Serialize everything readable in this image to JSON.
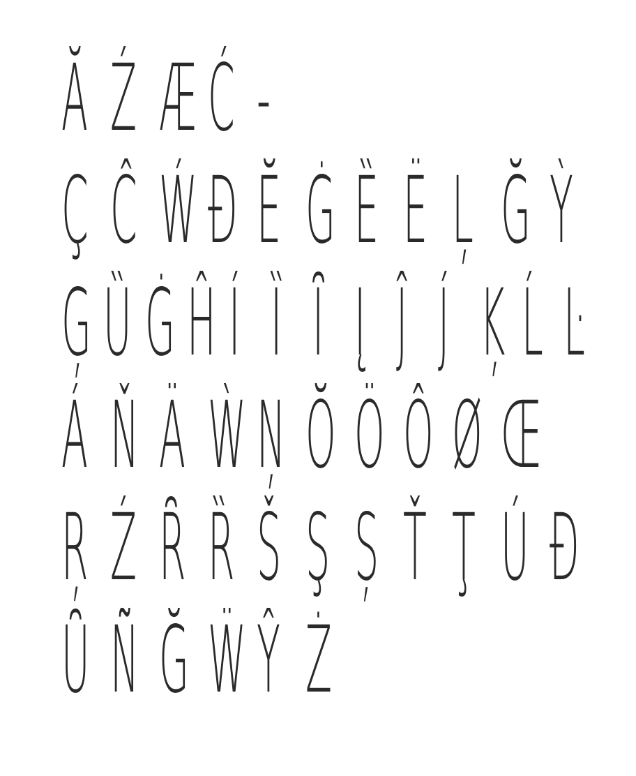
{
  "rows": [
    [
      "Ă",
      "Ź",
      "Æ",
      "Ć",
      "-"
    ],
    [
      "Ç",
      "Ĉ",
      "Ẃ",
      "Đ",
      "Ĕ",
      "Ġ",
      "Ȅ",
      "Ë",
      "Ļ",
      "Ğ",
      "Ỳ"
    ],
    [
      "Ģ",
      "Ȕ",
      "Ġ",
      "Ĥ",
      "Í",
      "Ȉ",
      "Ȋ",
      "Į",
      "Ĵ",
      "J́",
      "Ķ",
      "Ĺ",
      "Ŀ"
    ],
    [
      "Á",
      "Ň",
      "Ä",
      "Ẁ",
      "Ņ",
      "Ŏ",
      "Ö",
      "Ô",
      "Ø",
      "Œ"
    ],
    [
      "Ŗ",
      "Ź",
      "Ȓ",
      "Ȑ",
      "Š",
      "Ş",
      "Ș",
      "Ť",
      "Ţ",
      "Ú",
      "Đ"
    ],
    [
      "Ȗ",
      "Ñ",
      "Ğ",
      "Ẅ",
      "Ŷ",
      "Ż"
    ]
  ]
}
